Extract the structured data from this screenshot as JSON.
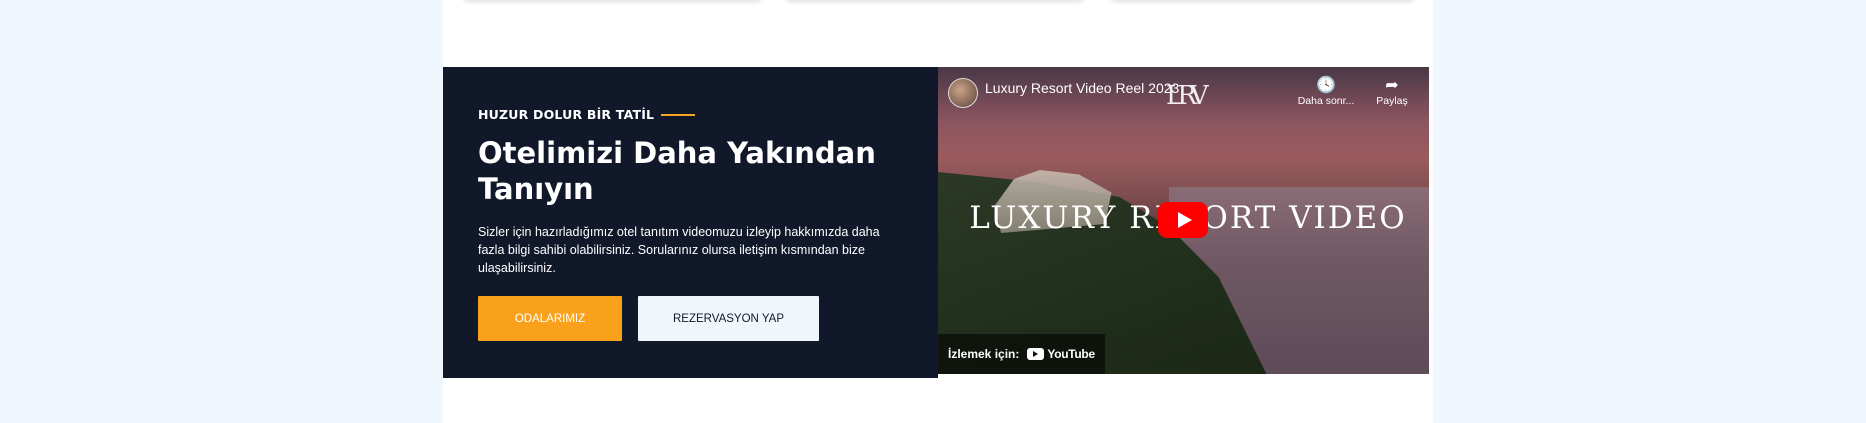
{
  "hero": {
    "eyebrow": "HUZUR DOLUR BİR TATİL",
    "title": "Otelimizi Daha Yakından Tanıyın",
    "description": "Sizler için hazırladığımız otel tanıtım videomuzu izleyip hakkımızda daha fazla bilgi sahibi olabilirsiniz. Sorularınız olursa iletişim kısmından bize ulaşabilirsiniz.",
    "primary_button": "ODALARIMIZ",
    "secondary_button": "REZERVASYON YAP",
    "accent_color": "#f9a11b",
    "panel_color": "#101829"
  },
  "video": {
    "title": "Luxury Resort Video Reel 2023",
    "logo_text": "LRV",
    "overlay_text": "LUXURY RESORT VIDEO",
    "watch_later_label": "Daha sonr...",
    "share_label": "Paylaş",
    "watch_on_label": "İzlemek için:",
    "youtube_label": "YouTube"
  }
}
